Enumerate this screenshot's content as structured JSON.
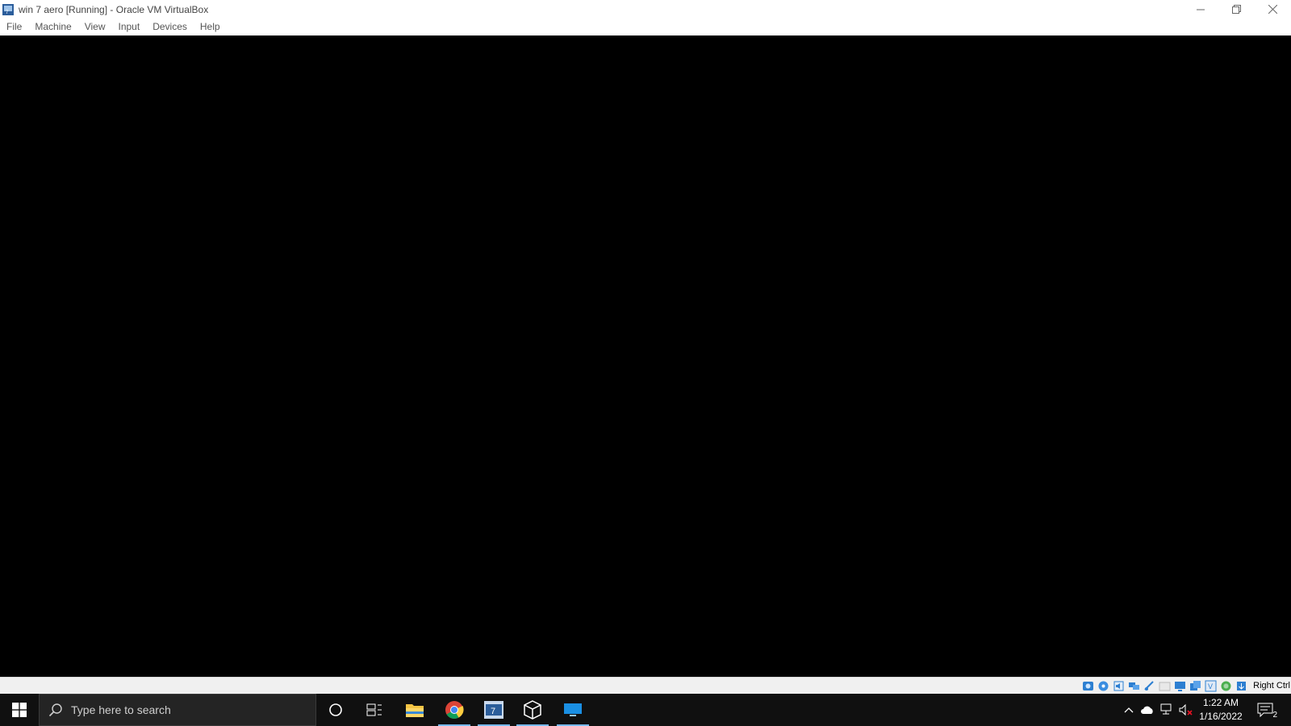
{
  "window": {
    "title": "win 7 aero [Running] - Oracle VM VirtualBox",
    "controls": [
      "minimize",
      "restore",
      "close"
    ]
  },
  "menubar": {
    "items": [
      {
        "label": "File"
      },
      {
        "label": "Machine"
      },
      {
        "label": "View"
      },
      {
        "label": "Input"
      },
      {
        "label": "Devices"
      },
      {
        "label": "Help"
      }
    ]
  },
  "statusbar": {
    "icons": [
      "hard-disk-icon",
      "optical-drive-icon",
      "audio-icon",
      "network-icon",
      "usb-icon",
      "shared-folders-icon",
      "display-icon",
      "video-capture-icon",
      "virtualization-icon",
      "cpu-icon",
      "mouse-integration-icon",
      "keyboard-icon"
    ],
    "host_key": "Right Ctrl"
  },
  "taskbar": {
    "search_placeholder": "Type here to search",
    "pinned": [
      {
        "name": "cortana",
        "icon": "cortana-circle-icon",
        "active": false
      },
      {
        "name": "task-view",
        "icon": "task-view-icon",
        "active": false
      },
      {
        "name": "file-explorer",
        "icon": "folder-icon",
        "active": false
      },
      {
        "name": "chrome",
        "icon": "chrome-icon",
        "active": true
      },
      {
        "name": "win7-vm",
        "icon": "virtualbox-vm-icon",
        "active": true
      },
      {
        "name": "virtualbox",
        "icon": "virtualbox-cube-icon",
        "active": true
      },
      {
        "name": "remote-desktop",
        "icon": "monitor-icon",
        "active": true
      }
    ],
    "tray": {
      "time": "1:22 AM",
      "date": "1/16/2022",
      "notification_count": "2"
    }
  }
}
